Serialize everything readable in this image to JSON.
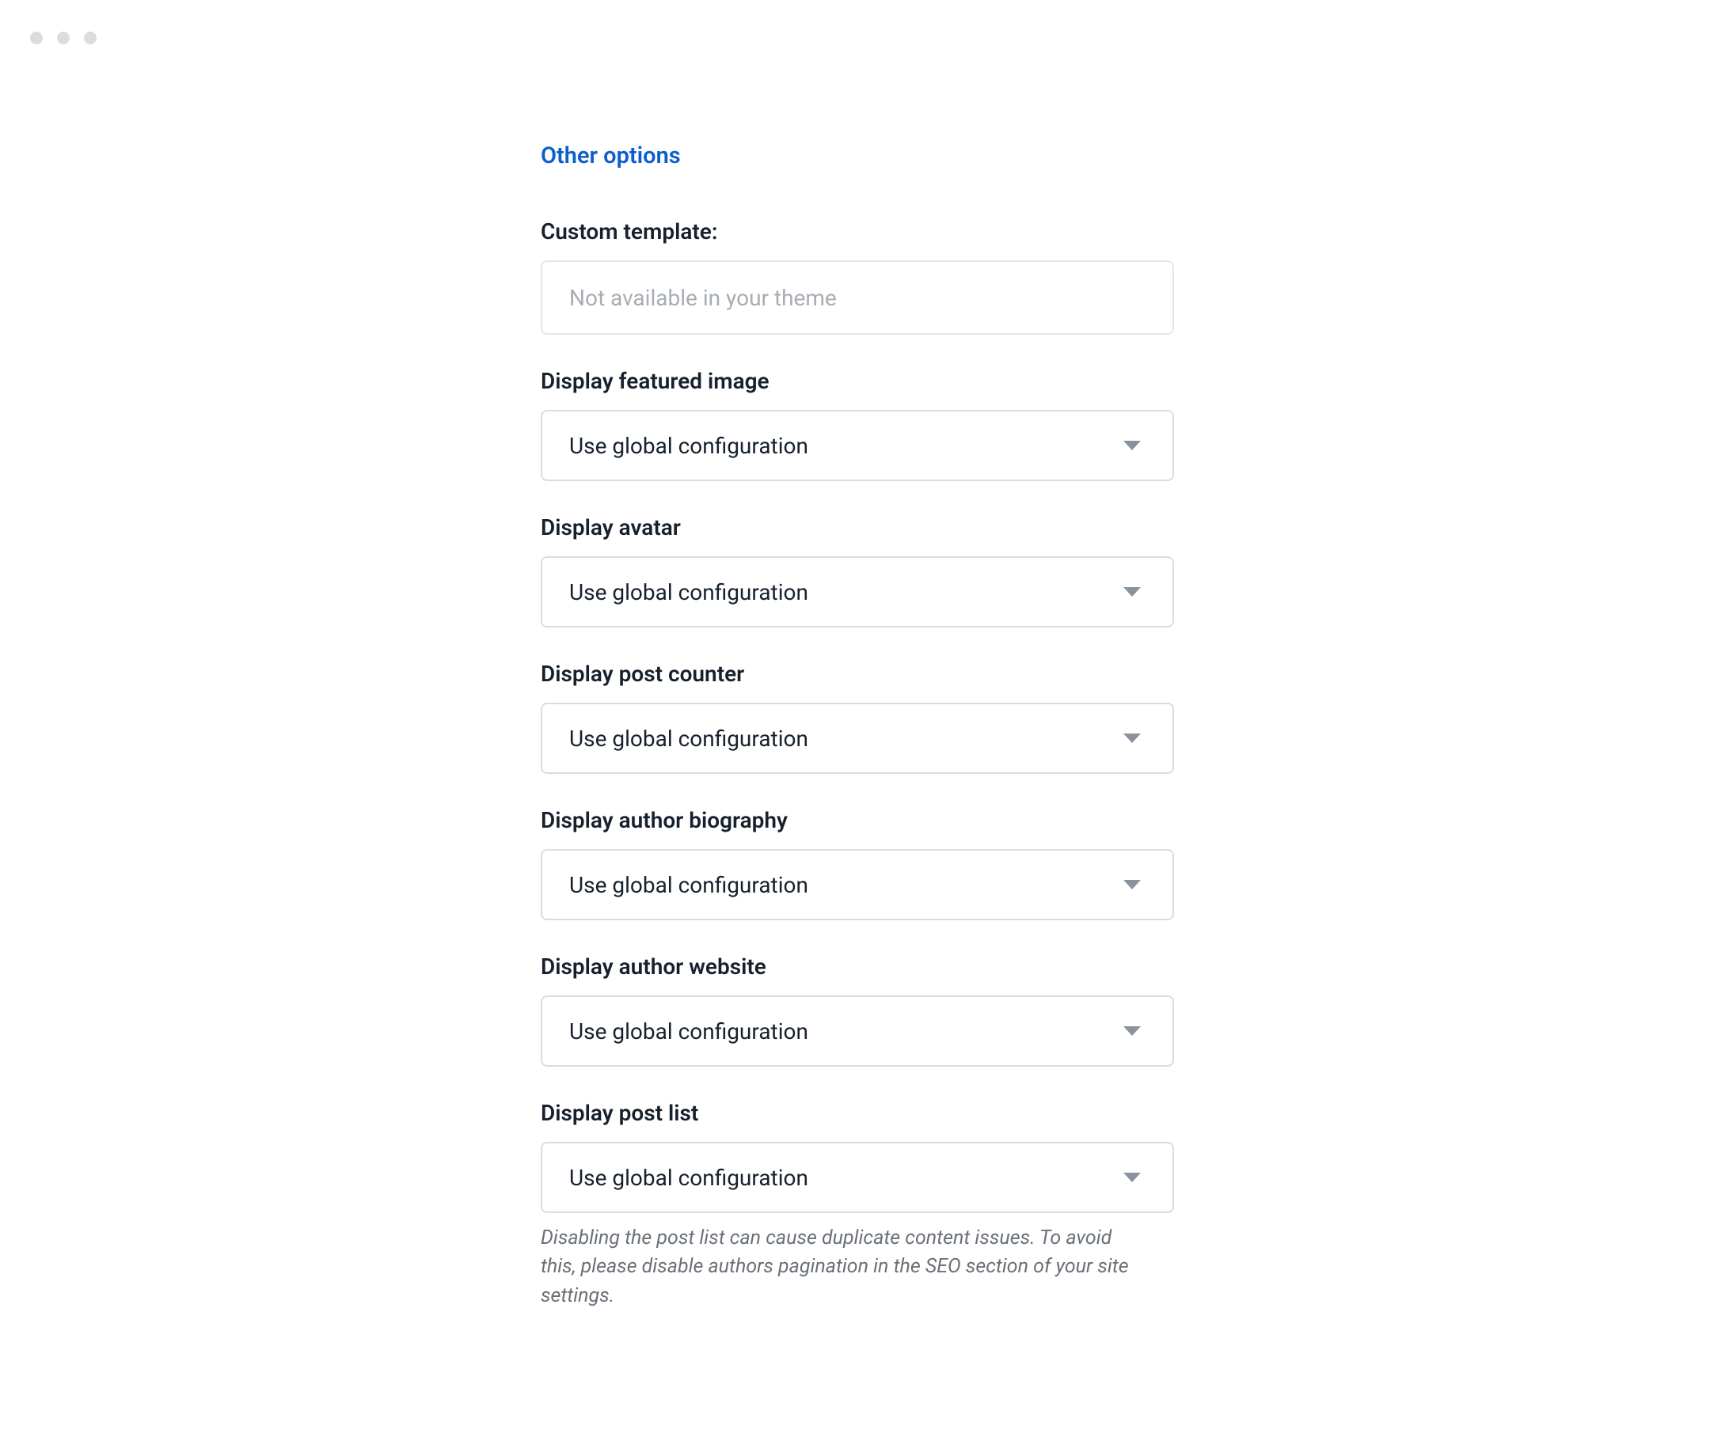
{
  "section_header": "Other options",
  "fields": {
    "custom_template": {
      "label": "Custom template:",
      "placeholder": "Not available in your theme"
    },
    "display_featured_image": {
      "label": "Display featured image",
      "value": "Use global configuration"
    },
    "display_avatar": {
      "label": "Display avatar",
      "value": "Use global configuration"
    },
    "display_post_counter": {
      "label": "Display post counter",
      "value": "Use global configuration"
    },
    "display_author_biography": {
      "label": "Display author biography",
      "value": "Use global configuration"
    },
    "display_author_website": {
      "label": "Display author website",
      "value": "Use global configuration"
    },
    "display_post_list": {
      "label": "Display post list",
      "value": "Use global configuration",
      "help_text": "Disabling the post list can cause duplicate content issues. To avoid this, please disable authors pagination in the SEO section of your site settings."
    }
  }
}
